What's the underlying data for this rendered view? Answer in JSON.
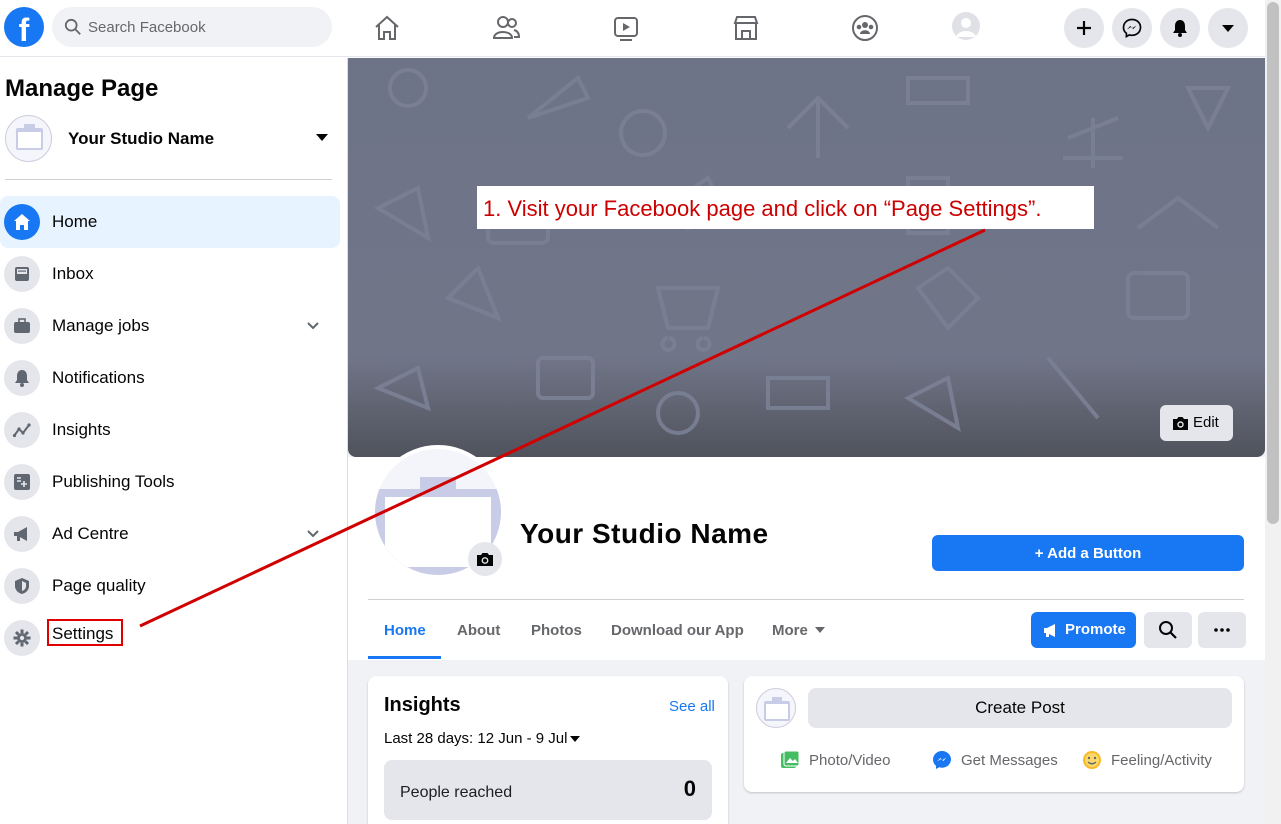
{
  "topbar": {
    "logo": "f",
    "search_placeholder": "Search Facebook",
    "nav_icons": [
      "home-icon",
      "friends-icon",
      "watch-icon",
      "marketplace-icon",
      "groups-icon",
      "profile-icon"
    ],
    "right_icons": [
      "plus-icon",
      "messenger-icon",
      "notifications-icon",
      "account-caret-icon"
    ]
  },
  "sidebar": {
    "title": "Manage Page",
    "page_name": "Your Studio Name",
    "items": [
      {
        "label": "Home",
        "icon": "home-icon"
      },
      {
        "label": "Inbox",
        "icon": "inbox-icon"
      },
      {
        "label": "Manage jobs",
        "icon": "briefcase-icon"
      },
      {
        "label": "Notifications",
        "icon": "bell-icon"
      },
      {
        "label": "Insights",
        "icon": "insights-icon"
      },
      {
        "label": "Publishing Tools",
        "icon": "publishing-icon"
      },
      {
        "label": "Ad Centre",
        "icon": "megaphone-icon"
      },
      {
        "label": "Page quality",
        "icon": "shield-icon"
      },
      {
        "label": "Settings",
        "icon": "gear-icon"
      }
    ]
  },
  "page": {
    "edit_label": "Edit",
    "name": "Your Studio Name",
    "add_button_label": "+ Add a Button",
    "tabs": [
      "Home",
      "About",
      "Photos",
      "Download our App",
      "More"
    ],
    "promote_label": "Promote"
  },
  "insights": {
    "title": "Insights",
    "see_all": "See all",
    "range": "Last 28 days: 12 Jun - 9 Jul",
    "people_reached_label": "People reached",
    "people_reached_value": "0"
  },
  "create_post": {
    "button_label": "Create Post",
    "actions": [
      "Photo/Video",
      "Get Messages",
      "Feeling/Activity"
    ]
  },
  "annotation": {
    "text": "1. Visit your Facebook page and click on “Page Settings”.",
    "color": "#cc0000"
  },
  "colors": {
    "brand": "#1877f2",
    "annotation_red": "#e00000"
  }
}
